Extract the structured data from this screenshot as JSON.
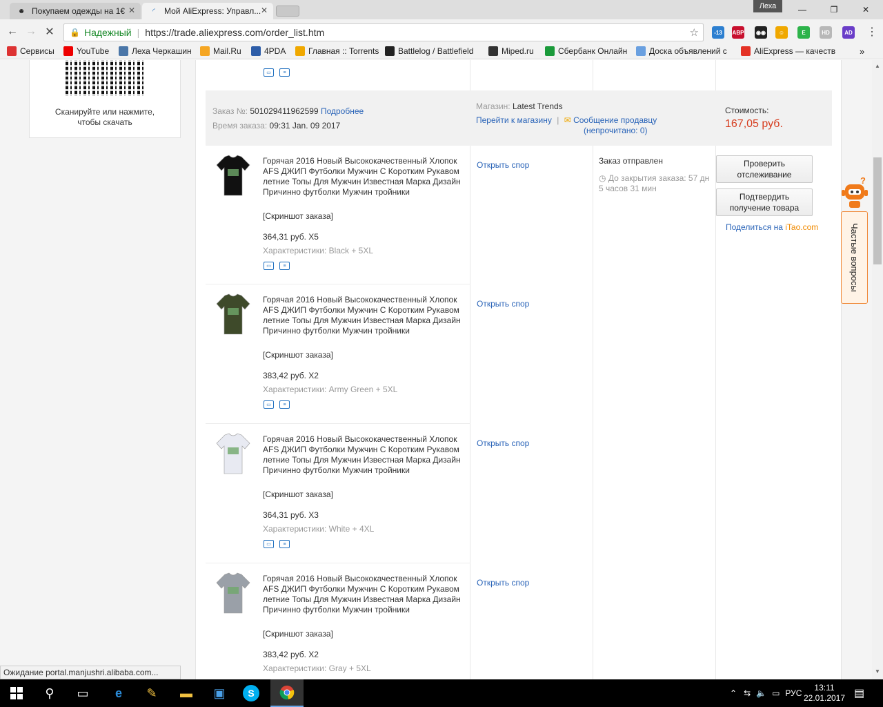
{
  "tabs": [
    {
      "title": "Покупаем одежды на 1€",
      "icon": "user-icon"
    },
    {
      "title": "Мой AliExpress: Управл...",
      "icon": "loading-icon"
    }
  ],
  "window": {
    "user": "Леха",
    "minimize": "—",
    "restore": "❐",
    "close": "✕"
  },
  "address": {
    "secure_label": "Надежный",
    "url": "https://trade.aliexpress.com/order_list.htm"
  },
  "extensions": [
    {
      "name": "weather-icon",
      "label": "-13",
      "color": "#2d7fd0"
    },
    {
      "name": "adblock-icon",
      "label": "ABP",
      "color": "#c8102e"
    },
    {
      "name": "tampermonkey-icon",
      "label": "◉◉",
      "color": "#222"
    },
    {
      "name": "smile-icon",
      "label": "☺",
      "color": "#f0a800"
    },
    {
      "name": "evernote-icon",
      "label": "E",
      "color": "#2db34a"
    },
    {
      "name": "hd-icon",
      "label": "HD",
      "color": "#b8b8b8"
    },
    {
      "name": "ae-icon",
      "label": "AD",
      "color": "#6a3dc8"
    }
  ],
  "bookmarks": [
    {
      "label": "Сервисы",
      "icon": "apps-icon",
      "color": "#d33"
    },
    {
      "label": "YouTube",
      "icon": "youtube-icon",
      "color": "#e00"
    },
    {
      "label": "Леха Черкашин",
      "icon": "vk-icon",
      "color": "#4a76a8"
    },
    {
      "label": "Mail.Ru",
      "icon": "mailru-icon",
      "color": "#f5a623"
    },
    {
      "label": "4PDA",
      "icon": "4pda-icon",
      "color": "#2d5da8"
    },
    {
      "label": "Главная :: Torrents",
      "icon": "torrents-icon",
      "color": "#f0a800"
    },
    {
      "label": "Battlelog / Battlefield",
      "icon": "battlelog-icon",
      "color": "#222"
    },
    {
      "label": "Miped.ru",
      "icon": "miped-icon",
      "color": "#333"
    },
    {
      "label": "Сбербанк Онлайн",
      "icon": "sberbank-icon",
      "color": "#1a9a3a"
    },
    {
      "label": "Доска объявлений с",
      "icon": "avito-icon",
      "color": "#6aa0e0"
    },
    {
      "label": "AliExpress — качеств",
      "icon": "aliexpress-icon",
      "color": "#e43225"
    }
  ],
  "qr": {
    "text_line1": "Сканируйте или нажмите,",
    "text_line2": "чтобы скачать"
  },
  "order": {
    "number_label": "Заказ №:",
    "number": "501029411962599",
    "details_link": "Подробнее",
    "time_label": "Время заказа:",
    "time": "09:31 Jan. 09 2017",
    "store_label": "Магазин:",
    "store": "Latest Trends",
    "goto_store": "Перейти к магазину",
    "message_seller": "Сообщение продавцу",
    "unread": "(непрочитано: 0)",
    "cost_label": "Стоимость:",
    "cost": "167,05 руб.",
    "status": "Заказ отправлен",
    "closing": "До закрытия заказа: 57 дн 5 часов 31 мин",
    "track_button": "Проверить отслеживание",
    "confirm_button": "Подтвердить получение товара",
    "share_prefix": "Поделиться на ",
    "share_brand": "iTao.com"
  },
  "items": [
    {
      "title": "Горячая 2016 Новый Высококачественный Хлопок AFS ДЖИП Футболки Мужчин С Коротким Рукавом летние Топы Для Мужчин Известная Марка Дизайн Причинно футболки Мужчин тройники",
      "snapshot": "[Скриншот заказа]",
      "price": "364,31 руб. X5",
      "props": "Характеристики: Black + 5XL",
      "dispute": "Открыть спор",
      "color": "#111"
    },
    {
      "title": "Горячая 2016 Новый Высококачественный Хлопок AFS ДЖИП Футболки Мужчин С Коротким Рукавом летние Топы Для Мужчин Известная Марка Дизайн Причинно футболки Мужчин тройники",
      "snapshot": "[Скриншот заказа]",
      "price": "383,42 руб. X2",
      "props": "Характеристики: Army Green + 5XL",
      "dispute": "Открыть спор",
      "color": "#3e4a2a"
    },
    {
      "title": "Горячая 2016 Новый Высококачественный Хлопок AFS ДЖИП Футболки Мужчин С Коротким Рукавом летние Топы Для Мужчин Известная Марка Дизайн Причинно футболки Мужчин тройники",
      "snapshot": "[Скриншот заказа]",
      "price": "364,31 руб. X3",
      "props": "Характеристики: White + 4XL",
      "dispute": "Открыть спор",
      "color": "#e8eaf2"
    },
    {
      "title": "Горячая 2016 Новый Высококачественный Хлопок AFS ДЖИП Футболки Мужчин С Коротким Рукавом летние Топы Для Мужчин Известная Марка Дизайн Причинно футболки Мужчин тройники",
      "snapshot": "[Скриншот заказа]",
      "price": "383,42 руб. X2",
      "props": "Характеристики: Gray + 5XL",
      "dispute": "Открыть спор",
      "color": "#9aa0a8"
    }
  ],
  "faq": "Частые вопросы",
  "status_bar": "Ожидание portal.manjushri.alibaba.com...",
  "taskbar": {
    "lang": "РУС",
    "time": "13:11",
    "date": "22.01.2017"
  }
}
